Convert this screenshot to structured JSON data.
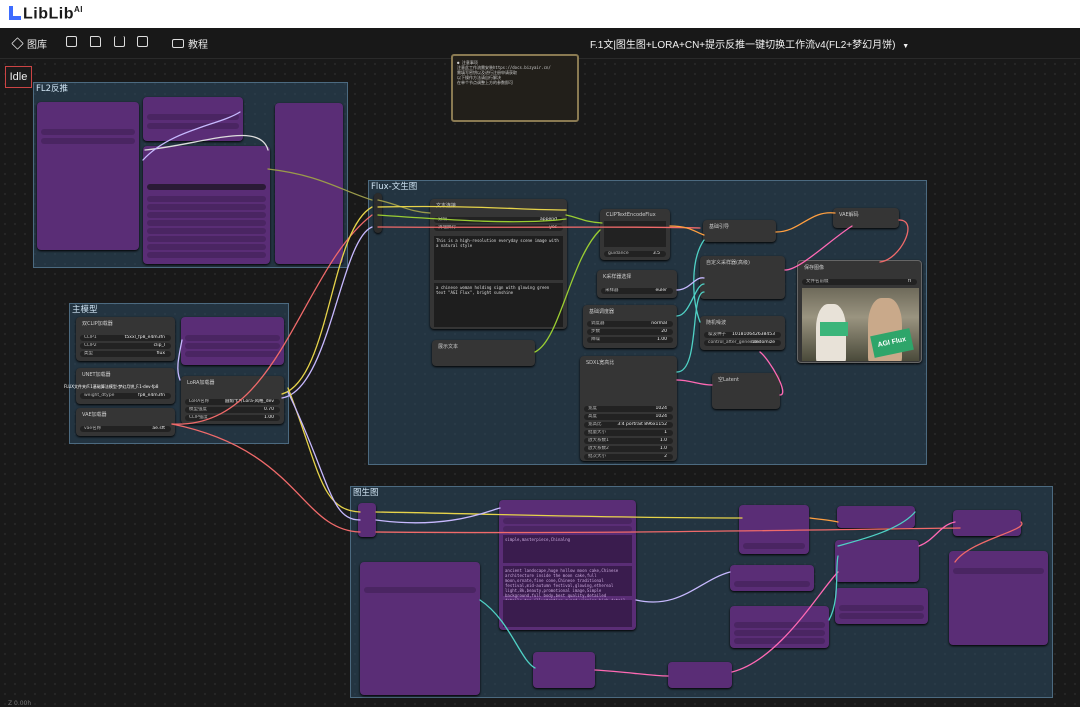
{
  "brand": {
    "name": "LibLib",
    "suffix": "AI"
  },
  "toolbar": {
    "gallery_label": "图库",
    "tutorial_label": "教程",
    "workflow_title": "F.1文|图生图+LORA+CN+提示反推一键切换工作流v4(FL2+梦幻月饼)",
    "dropdown_glyph": "▼"
  },
  "status": {
    "idle": "Idle"
  },
  "groups": {
    "fl2": "FL2反推",
    "main_model": "主模型",
    "flux_t2i": "Flux-文生图",
    "i2i": "图生图"
  },
  "note_text": "● 注意事项\n注意此工作流需安装https://docs.bizyair.cn/\n需填写密钥以及进行注册申请获取\n以下操作方法请自行解决\n在单个节点调整上方的参数即可",
  "nodes": {
    "dual_clip": {
      "title": "双CLIP加载器",
      "rows": [
        [
          "CLIP1",
          "t5xxl_fp8_e4m3fn"
        ],
        [
          "CLIP2",
          "clip_l"
        ],
        [
          "类型",
          "flux"
        ]
      ]
    },
    "unet": {
      "title": "UNET加载器",
      "rows": [
        [
          "UNET名称",
          "FLUX文件夹/F.1基础算法模型-梦幻月饼_F.1-dev-fp8"
        ],
        [
          "weight_dtype",
          "fp8_e4m3fn"
        ]
      ]
    },
    "vae": {
      "title": "VAE加载器",
      "rows": [
        [
          "vae名称",
          "ae.sft"
        ]
      ]
    },
    "lora": {
      "title": "LoRA加载器",
      "rows": [
        [
          "LoRA名称",
          "圆角卡片Lora-风格_dev"
        ],
        [
          "模型强度",
          "0.70"
        ],
        [
          "CLIP强度",
          "1.00"
        ]
      ]
    },
    "text_concat": {
      "title": "文本连接",
      "rows": [
        [
          "分隔",
          "append"
        ],
        [
          "清理换行",
          "yes"
        ]
      ]
    },
    "clip_encode": {
      "title": "CLIPTextEncodeFlux",
      "rows": [
        [
          "guidance",
          "3.5"
        ]
      ]
    },
    "ksampler_select": {
      "title": "K采样器选择",
      "rows": [
        [
          "采样器",
          "euler"
        ]
      ]
    },
    "scheduler": {
      "title": "基础调度器",
      "rows": [
        [
          "调度器",
          "normal"
        ],
        [
          "步数",
          "20"
        ],
        [
          "降噪",
          "1.00"
        ]
      ]
    },
    "basic_guider": {
      "title": "基础引导",
      "rows": []
    },
    "custom_sampler": {
      "title": "自定义采样器(高级)",
      "rows": []
    },
    "random_noise": {
      "title": "随机噪波",
      "rows": [
        [
          "噪波种子",
          "101810642638453"
        ],
        [
          "control_after_generate",
          "randomize"
        ]
      ]
    },
    "vae_decode": {
      "title": "VAE解码",
      "rows": []
    },
    "preview": {
      "title": "保存图像",
      "rows": [
        [
          "文件名前缀",
          "fl"
        ]
      ]
    },
    "empty_latent": {
      "title": "空Latent",
      "rows": []
    },
    "sdxl_res": {
      "title": "SDXL宽高比",
      "rows": [
        [
          "宽度",
          "1024"
        ],
        [
          "高度",
          "1024"
        ],
        [
          "宽高比",
          "3:4 portrait 896x1152"
        ],
        [
          "批量大小",
          "1"
        ],
        [
          "放大系数1",
          "1.0"
        ],
        [
          "放大系数2",
          "1.0"
        ],
        [
          "批次大小",
          "2"
        ]
      ]
    },
    "show_text": {
      "title": "展示文本",
      "rows": []
    }
  },
  "prompts": {
    "prompt_a": "This is a high-resolution everyday scene image with a natural style",
    "prompt_b": "a chinese woman holding sign with glowing green text \"AGI Flux\", bright sunshine",
    "prompt_c": "ancient landscape,huge hollow moon cake,Chinese architecture inside the moon cake,full moon,ornate,fine cone,Chinese traditional festival,mid-autumn festival,glowing,ethereal light,8k,beauty,promotional image,Simple background,full body,best quality,detailed details,top illustration,award winning,high detail",
    "prompt_d": "simple,masterpiece,Chinalng"
  },
  "preview_sign": "AGI Flux",
  "zoom_text": "Z 0.00h"
}
